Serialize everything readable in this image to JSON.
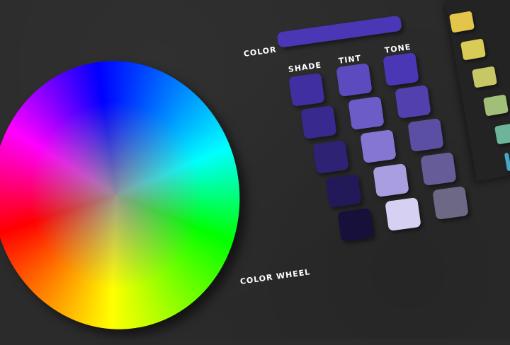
{
  "labels": {
    "color": "COLOR",
    "shade": "SHADE",
    "tint": "TINT",
    "tone": "TONE",
    "wheel": "COLOR WHEEL"
  },
  "base_color": "#4a37b5",
  "shade": [
    "#3f2fa0",
    "#37298d",
    "#2e2275",
    "#221a58",
    "#16103a"
  ],
  "tint": [
    "#5c4bbf",
    "#6c5cc7",
    "#8576d3",
    "#a89ee0",
    "#d6d1f2"
  ],
  "tone": [
    "#4a37b5",
    "#5140ad",
    "#5a4fa3",
    "#655c98",
    "#6c6886"
  ],
  "side_palette": [
    "#e2c54a",
    "#d9cc56",
    "#c8c766",
    "#a2bf79",
    "#6cb59a",
    "#45a7c6"
  ]
}
